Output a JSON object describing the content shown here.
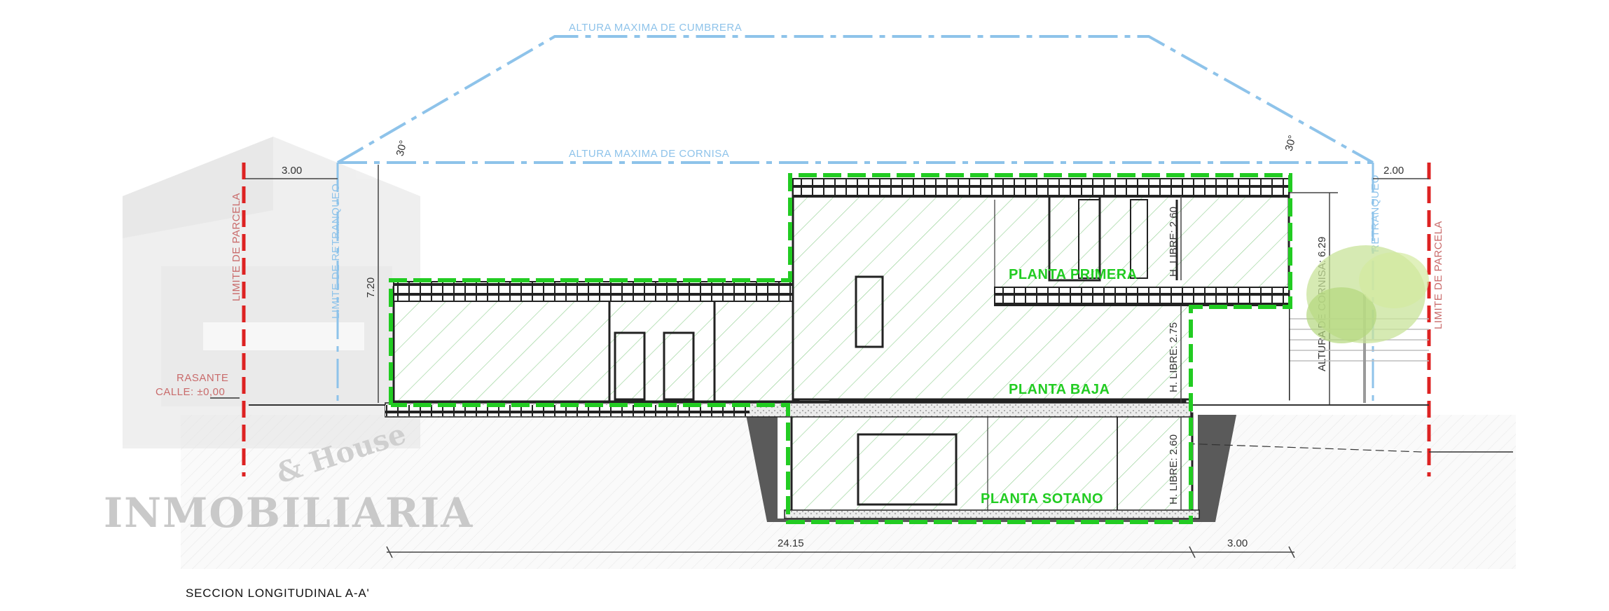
{
  "drawing": {
    "title": "SECCION LONGITUDINAL A-A'",
    "labels": {
      "ridge_height": "ALTURA MAXIMA DE CUMBRERA",
      "cornice_height": "ALTURA MAXIMA DE CORNISA",
      "plot_limit_left": "LIMITE DE PARCELA",
      "plot_limit_right": "LIMITE DE PARCELA",
      "setback_left": "LIMITE DE RETRANQUEO",
      "setback_right": "RETRANQUEO",
      "street_level_1": "RASANTE",
      "street_level_2": "CALLE: ±0,00",
      "cornice_total": "ALTURA DE CORNISA: 6.29"
    },
    "angles": {
      "left": "30°",
      "right": "30°"
    },
    "dimensions": {
      "setback_left": "3.00",
      "setback_right": "2.00",
      "height_left": "7.20",
      "total_length": "24.15",
      "rear_length": "3.00"
    },
    "floors": {
      "first": {
        "name": "PLANTA PRIMERA",
        "clear_height": "H. LIBRE: 2.60"
      },
      "ground": {
        "name": "PLANTA BAJA",
        "clear_height": "H. LIBRE: 2.75"
      },
      "basement": {
        "name": "PLANTA SOTANO",
        "clear_height": "H. LIBRE: 2.60"
      }
    },
    "watermark": {
      "line1": "& House",
      "line2": "INMOBILIARIA"
    },
    "colors": {
      "limit_red": "#dd2222",
      "regulation_blue": "#8ec3ea",
      "floor_green": "#22cc22",
      "hatch": "#7fbf7f"
    }
  }
}
